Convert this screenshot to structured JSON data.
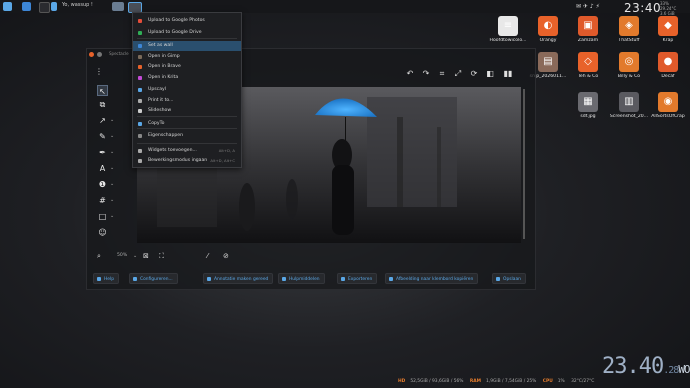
{
  "panel": {
    "task_label": "Yo, wassup !",
    "clock": "23:40",
    "clock_side": "33%\n29.24°C\n3.6 GiB"
  },
  "context_menu": {
    "items": [
      {
        "label": "Upload to Google Photos",
        "color": "#e44d3a"
      },
      {
        "label": "Upload to Google Drive",
        "color": "#2fae56"
      },
      {
        "label": "Set as wall",
        "color": "#3d86d6",
        "highlighted": true
      },
      {
        "label": "Open in Gimp",
        "color": "#7a6a5a"
      },
      {
        "label": "Open in Brave",
        "color": "#e8622a"
      },
      {
        "label": "Open in Krita",
        "color": "#c44ad6"
      },
      {
        "label": "Upscayl",
        "color": "#5aa7e6"
      },
      {
        "label": "Print it to...",
        "color": "#aaaaaa"
      },
      {
        "label": "Slideshow",
        "color": "#cccccc"
      },
      {
        "label": "CopyTo",
        "color": "#5aa7e6"
      },
      {
        "label": "Eigenschappen",
        "color": "#888888"
      },
      {
        "label": "Widgets toevoegen...",
        "shortcut": "Alt+D, A",
        "color": "#aaaaaa"
      },
      {
        "label": "Bewerkingsmodus ingaan",
        "shortcut": "Alt+D, Alt+C",
        "color": "#aaaaaa"
      }
    ]
  },
  "window": {
    "title": "Spectacle",
    "zoom": "50%",
    "toolbar_icons": [
      "undo-icon",
      "redo-icon",
      "crop-icon",
      "resize-icon",
      "rotate-icon",
      "flip-icon",
      "more-icon"
    ],
    "left_tools": [
      "select-icon",
      "crop-tool-icon",
      "arrow-icon",
      "pen-icon",
      "highlighter-icon",
      "text-icon",
      "number-icon",
      "blur-icon",
      "rectangle-icon",
      "emoji-icon"
    ],
    "actions": [
      {
        "label": "Help"
      },
      {
        "label": "Configureren..."
      },
      {
        "label": "Annotatie maken gereed"
      },
      {
        "label": "Hulpmiddelen"
      },
      {
        "label": "Exporteren"
      },
      {
        "label": "Afbeelding naar klembord kopiëren"
      },
      {
        "label": "Opslaan"
      }
    ]
  },
  "desktop_icons": [
    {
      "label": "Hoofdtowicolo...",
      "color": "#e8e8e8",
      "glyph": "≡"
    },
    {
      "label": "Orangy",
      "color": "#e8622a",
      "glyph": "◐"
    },
    {
      "label": "Zamzam",
      "color": "#e05a2b",
      "glyph": "▣"
    },
    {
      "label": "ThatStuff",
      "color": "#e27a2c",
      "glyph": "◈"
    },
    {
      "label": "Krap",
      "color": "#e8622a",
      "glyph": "◆"
    },
    {
      "label": "snip_2026011...",
      "color": "#8a6a5a",
      "glyph": "▤"
    },
    {
      "label": "Teh & Co",
      "color": "#e8622a",
      "glyph": "◇"
    },
    {
      "label": "Billy & Co",
      "color": "#e27a2c",
      "glyph": "◎"
    },
    {
      "label": "Decaf",
      "color": "#e05a2b",
      "glyph": "●"
    },
    {
      "label": "sdf.jpg",
      "color": "#6a6a70",
      "glyph": "▦"
    },
    {
      "label": "Screenshot_20...",
      "color": "#5a5a60",
      "glyph": "▥"
    },
    {
      "label": "AllSortsOfCrap",
      "color": "#e27a2c",
      "glyph": "◉"
    }
  ],
  "status": {
    "time": "23.40",
    "seconds": "28",
    "weekday": "WO",
    "hd_label": "HD",
    "hd_value": "52,5GiB / 93,6GiB / 56%",
    "ram_label": "RAM",
    "ram_value": "1,9GiB / 7,54GiB / 25%",
    "cpu_label": "CPU",
    "cpu_value": "1%",
    "temp_value": "32°C/27°C"
  },
  "colors": {
    "accent": "#5aa7e6",
    "status_label": "#e77d2d",
    "umbrella": "#2a8fe0",
    "menu_highlight": "#2a4f6e"
  }
}
